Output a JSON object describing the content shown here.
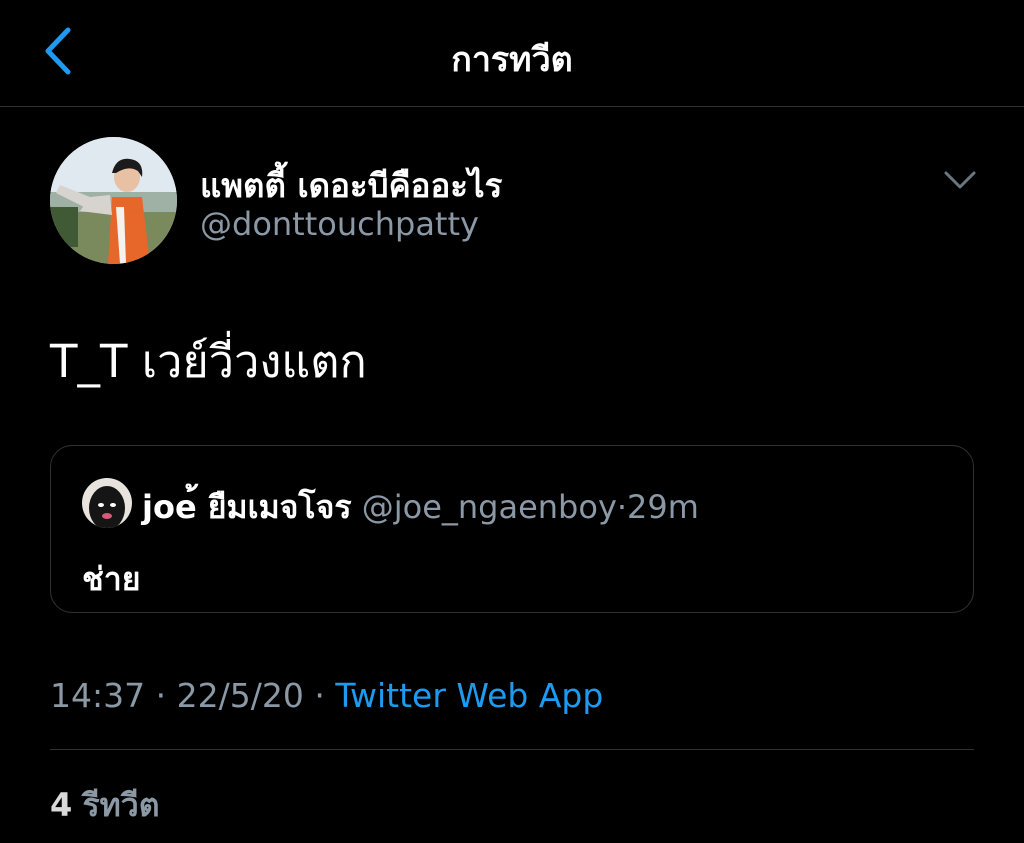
{
  "header": {
    "title": "การทวีต",
    "back_icon": "chevron-left-icon"
  },
  "colors": {
    "accent": "#1d9bf0",
    "background": "#000000",
    "secondary_text": "#8b98a5",
    "border": "#2f3336"
  },
  "tweet": {
    "author": {
      "display_name": "แพตตี้ เดอะบีคืออะไร",
      "handle": "@donttouchpatty"
    },
    "menu_icon": "chevron-down-icon",
    "text": "T_T เวย์วี่วงแตก",
    "quoted": {
      "display_name": "joe้ ยืมเมจโจร",
      "handle": "@joe_ngaenboy",
      "separator": "·",
      "time": "29m",
      "text": "ช่าย"
    },
    "meta": {
      "time": "14:37",
      "separator": "·",
      "date": "22/5/20",
      "source": "Twitter Web App"
    },
    "stats": {
      "retweet_count": "4",
      "retweet_label": "รีทวีต"
    }
  }
}
